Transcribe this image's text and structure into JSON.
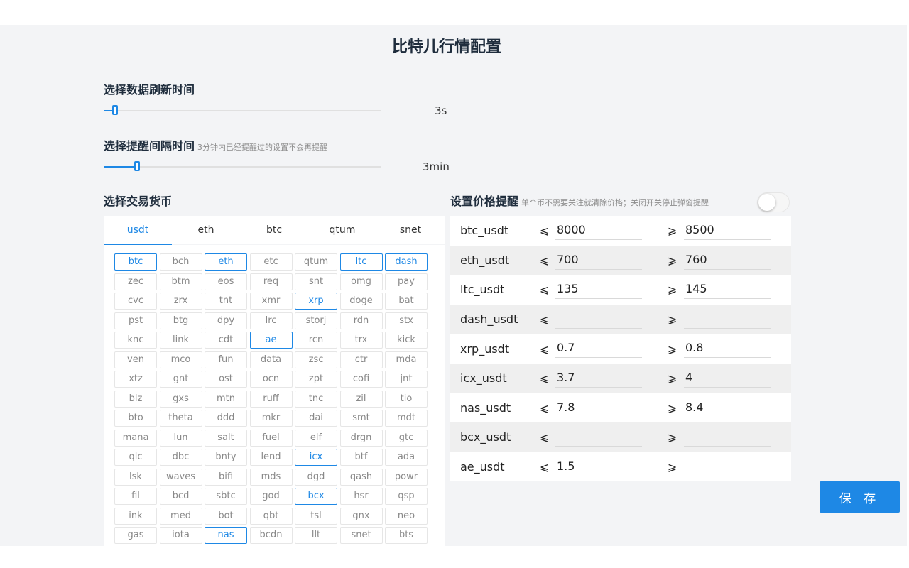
{
  "title": "比特儿行情配置",
  "refresh": {
    "label": "选择数据刷新时间",
    "value_text": "3s",
    "fraction": 0.02
  },
  "interval": {
    "label": "选择提醒间隔时间",
    "hint": "3分钟内已经提醒过的设置不会再提醒",
    "value_text": "3min",
    "fraction": 0.1
  },
  "coins": {
    "label": "选择交易货币",
    "tabs": [
      "usdt",
      "eth",
      "btc",
      "qtum",
      "snet"
    ],
    "active_tab": "usdt",
    "items": [
      "btc",
      "bch",
      "eth",
      "etc",
      "qtum",
      "ltc",
      "dash",
      "zec",
      "btm",
      "eos",
      "req",
      "snt",
      "omg",
      "pay",
      "cvc",
      "zrx",
      "tnt",
      "xmr",
      "xrp",
      "doge",
      "bat",
      "pst",
      "btg",
      "dpy",
      "lrc",
      "storj",
      "rdn",
      "stx",
      "knc",
      "link",
      "cdt",
      "ae",
      "rcn",
      "trx",
      "kick",
      "ven",
      "mco",
      "fun",
      "data",
      "zsc",
      "ctr",
      "mda",
      "xtz",
      "gnt",
      "ost",
      "ocn",
      "zpt",
      "cofi",
      "jnt",
      "blz",
      "gxs",
      "mtn",
      "ruff",
      "tnc",
      "zil",
      "tio",
      "bto",
      "theta",
      "ddd",
      "mkr",
      "dai",
      "smt",
      "mdt",
      "mana",
      "lun",
      "salt",
      "fuel",
      "elf",
      "drgn",
      "gtc",
      "qlc",
      "dbc",
      "bnty",
      "lend",
      "icx",
      "btf",
      "ada",
      "lsk",
      "waves",
      "bifi",
      "mds",
      "dgd",
      "qash",
      "powr",
      "fil",
      "bcd",
      "sbtc",
      "god",
      "bcx",
      "hsr",
      "qsp",
      "ink",
      "med",
      "bot",
      "qbt",
      "tsl",
      "gnx",
      "neo",
      "gas",
      "iota",
      "nas",
      "bcdn",
      "llt",
      "snet",
      "bts"
    ],
    "selected": [
      "btc",
      "eth",
      "ltc",
      "dash",
      "xrp",
      "ae",
      "icx",
      "bcx",
      "nas"
    ]
  },
  "alerts": {
    "label": "设置价格提醒",
    "hint": "单个币不需要关注就清除价格；关闭开关停止弹窗提醒",
    "toggle_on": false,
    "le_symbol": "⩽",
    "ge_symbol": "⩾",
    "rows": [
      {
        "pair": "btc_usdt",
        "low": "8000",
        "high": "8500"
      },
      {
        "pair": "eth_usdt",
        "low": "700",
        "high": "760"
      },
      {
        "pair": "ltc_usdt",
        "low": "135",
        "high": "145"
      },
      {
        "pair": "dash_usdt",
        "low": "",
        "high": ""
      },
      {
        "pair": "xrp_usdt",
        "low": "0.7",
        "high": "0.8"
      },
      {
        "pair": "icx_usdt",
        "low": "3.7",
        "high": "4"
      },
      {
        "pair": "nas_usdt",
        "low": "7.8",
        "high": "8.4"
      },
      {
        "pair": "bcx_usdt",
        "low": "",
        "high": ""
      },
      {
        "pair": "ae_usdt",
        "low": "1.5",
        "high": ""
      }
    ]
  },
  "save_label": "保 存",
  "colors": {
    "accent": "#1e88e5",
    "panel_bg": "#f3f4f6"
  }
}
